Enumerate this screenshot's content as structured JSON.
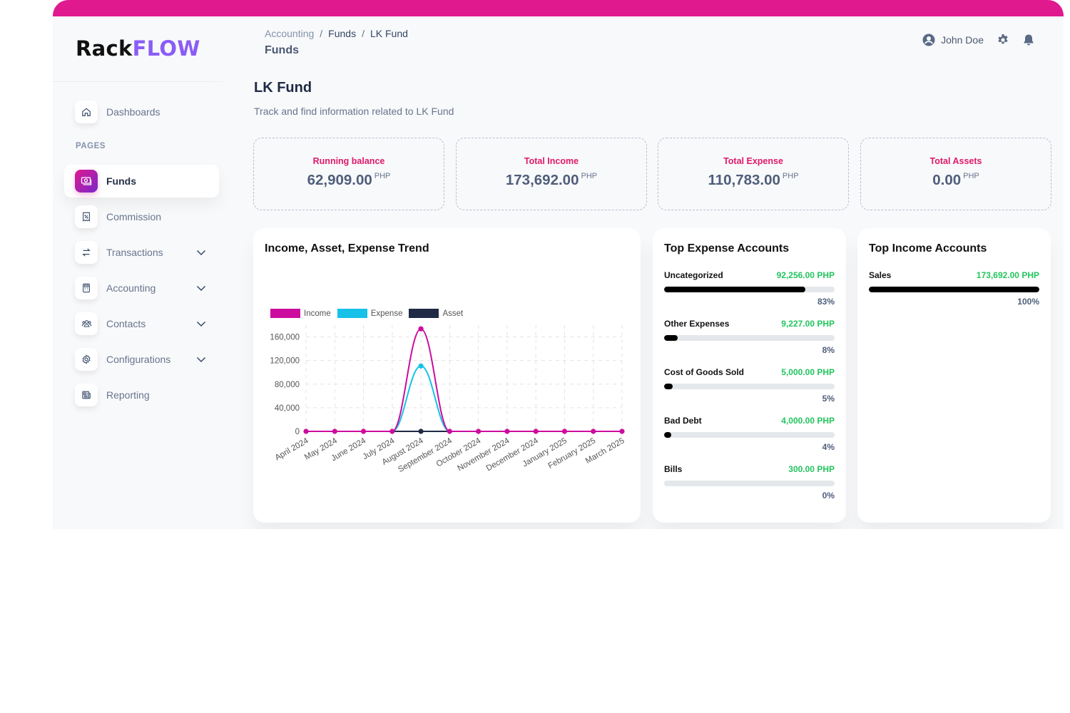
{
  "brand": {
    "part1": "Rack",
    "part2": "FLOW"
  },
  "colors": {
    "accent": "#e0198f",
    "brand_purple": "#8b5cf6",
    "income": "#cc0c9e",
    "expense": "#17c1e8",
    "asset": "#1f2a44",
    "positive_amount": "#22c55e",
    "stat_label": "#e0196b"
  },
  "sidebar": {
    "top_item": {
      "label": "Dashboards",
      "icon": "home-icon"
    },
    "section_title": "PAGES",
    "items": [
      {
        "label": "Funds",
        "icon": "money-icon",
        "active": true,
        "expandable": false
      },
      {
        "label": "Commission",
        "icon": "receipt-percent-icon",
        "active": false,
        "expandable": false
      },
      {
        "label": "Transactions",
        "icon": "arrows-exchange-icon",
        "active": false,
        "expandable": true
      },
      {
        "label": "Accounting",
        "icon": "calculator-icon",
        "active": false,
        "expandable": true
      },
      {
        "label": "Contacts",
        "icon": "users-icon",
        "active": false,
        "expandable": true
      },
      {
        "label": "Configurations",
        "icon": "gear-icon",
        "active": false,
        "expandable": true
      },
      {
        "label": "Reporting",
        "icon": "newspaper-icon",
        "active": false,
        "expandable": false
      }
    ]
  },
  "header": {
    "breadcrumb": [
      "Accounting",
      "Funds",
      "LK Fund"
    ],
    "breadcrumb_separator": "/",
    "title": "Funds",
    "user_name": "John Doe"
  },
  "main": {
    "title": "LK Fund",
    "subtitle": "Track and find information related to LK Fund"
  },
  "stats": [
    {
      "label": "Running balance",
      "value": "62,909.00",
      "unit": "PHP"
    },
    {
      "label": "Total Income",
      "value": "173,692.00",
      "unit": "PHP"
    },
    {
      "label": "Total Expense",
      "value": "110,783.00",
      "unit": "PHP"
    },
    {
      "label": "Total Assets",
      "value": "0.00",
      "unit": "PHP"
    }
  ],
  "trend_card": {
    "title": "Income, Asset, Expense Trend"
  },
  "chart_data": {
    "type": "line",
    "title": "Income, Asset, Expense Trend",
    "xlabel": "",
    "ylabel": "",
    "categories": [
      "April 2024",
      "May 2024",
      "June 2024",
      "July 2024",
      "August 2024",
      "September 2024",
      "October 2024",
      "November 2024",
      "December 2024",
      "January 2025",
      "February 2025",
      "March 2025"
    ],
    "series": [
      {
        "name": "Income",
        "color": "#cc0c9e",
        "values": [
          0,
          0,
          0,
          0,
          173692,
          0,
          0,
          0,
          0,
          0,
          0,
          0
        ]
      },
      {
        "name": "Expense",
        "color": "#17c1e8",
        "values": [
          0,
          0,
          0,
          0,
          110783,
          0,
          0,
          0,
          0,
          0,
          0,
          0
        ]
      },
      {
        "name": "Asset",
        "color": "#1f2a44",
        "values": [
          0,
          0,
          0,
          0,
          0,
          0,
          0,
          0,
          0,
          0,
          0,
          0
        ]
      }
    ],
    "yticks": [
      0,
      40000,
      80000,
      120000,
      160000
    ],
    "ytick_labels": [
      "0",
      "40,000",
      "80,000",
      "120,000",
      "160,000"
    ],
    "ylim": [
      0,
      180000
    ],
    "grid": true,
    "legend_position": "top-left",
    "smooth": true
  },
  "expense_accounts": {
    "title": "Top Expense Accounts",
    "items": [
      {
        "name": "Uncategorized",
        "amount": "92,256.00 PHP",
        "percent": 83
      },
      {
        "name": "Other Expenses",
        "amount": "9,227.00 PHP",
        "percent": 8
      },
      {
        "name": "Cost of Goods Sold",
        "amount": "5,000.00 PHP",
        "percent": 5
      },
      {
        "name": "Bad Debt",
        "amount": "4,000.00 PHP",
        "percent": 4
      },
      {
        "name": "Bills",
        "amount": "300.00 PHP",
        "percent": 0
      }
    ]
  },
  "income_accounts": {
    "title": "Top Income Accounts",
    "items": [
      {
        "name": "Sales",
        "amount": "173,692.00 PHP",
        "percent": 100
      }
    ]
  }
}
